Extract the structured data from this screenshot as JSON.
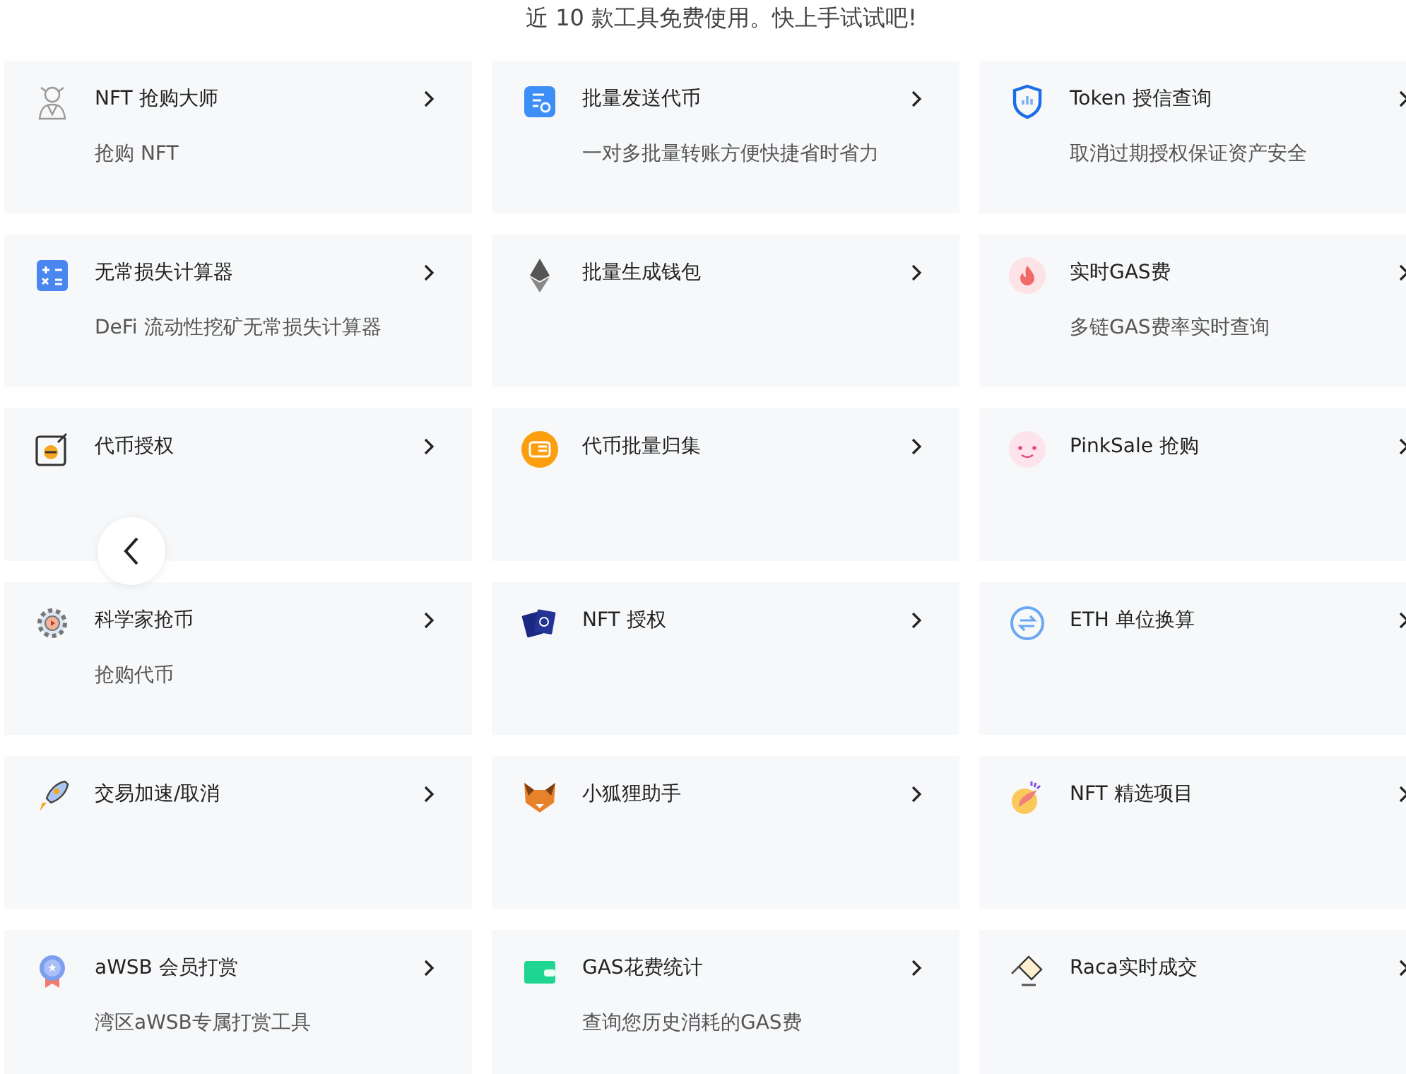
{
  "intro": "近 10 款工具免费使用。快上手试试吧!",
  "tools": [
    {
      "title": "NFT 抢购大师",
      "description": "抢购 NFT"
    },
    {
      "title": "批量发送代币",
      "description": "一对多批量转账方便快捷省时省力"
    },
    {
      "title": "Token 授信查询",
      "description": "取消过期授权保证资产安全"
    },
    {
      "title": "无常损失计算器",
      "description": "DeFi 流动性挖矿无常损失计算器"
    },
    {
      "title": "批量生成钱包"
    },
    {
      "title": "实时GAS费",
      "description": "多链GAS费率实时查询"
    },
    {
      "title": "代币授权"
    },
    {
      "title": "代币批量归集"
    },
    {
      "title": "PinkSale 抢购"
    },
    {
      "title": "科学家抢币",
      "description": "抢购代币"
    },
    {
      "title": "NFT 授权"
    },
    {
      "title": "ETH 单位换算"
    },
    {
      "title": "交易加速/取消"
    },
    {
      "title": "小狐狸助手"
    },
    {
      "title": "NFT 精选项目"
    },
    {
      "title": "aWSB 会员打赏",
      "description": "湾区aWSB专属打赏工具"
    },
    {
      "title": "GAS花费统计",
      "description": "查询您历史消耗的GAS费"
    },
    {
      "title": "Raca实时成交"
    }
  ]
}
